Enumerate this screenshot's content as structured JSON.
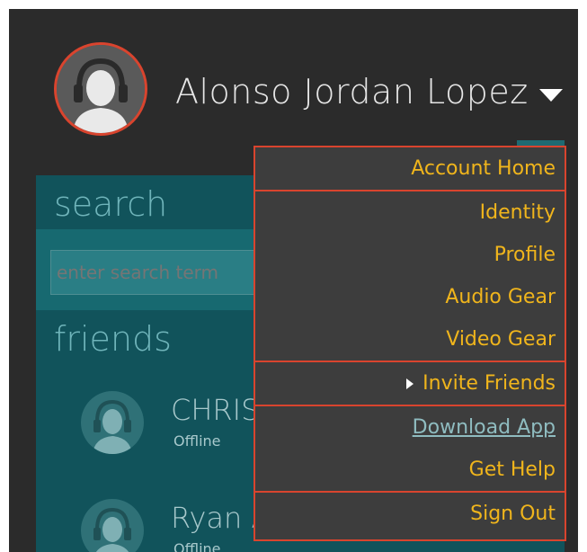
{
  "header": {
    "user_name": "Alonso Jordan Lopez"
  },
  "sidebar": {
    "search_title": "search",
    "search_placeholder": "enter search term",
    "friends_title": "friends",
    "friends": [
      {
        "name": "CHRIS F",
        "status": "Offline"
      },
      {
        "name": "Ryan All",
        "status": "Offline"
      }
    ]
  },
  "menu": {
    "account_home": "Account Home",
    "identity": "Identity",
    "profile": "Profile",
    "audio_gear": "Audio Gear",
    "video_gear": "Video Gear",
    "invite_friends": "Invite Friends",
    "download_app": "Download App",
    "get_help": "Get Help",
    "sign_out": "Sign Out"
  },
  "colors": {
    "accent": "#d9442e",
    "menu_text": "#f0b51c",
    "panel": "#11535b"
  }
}
